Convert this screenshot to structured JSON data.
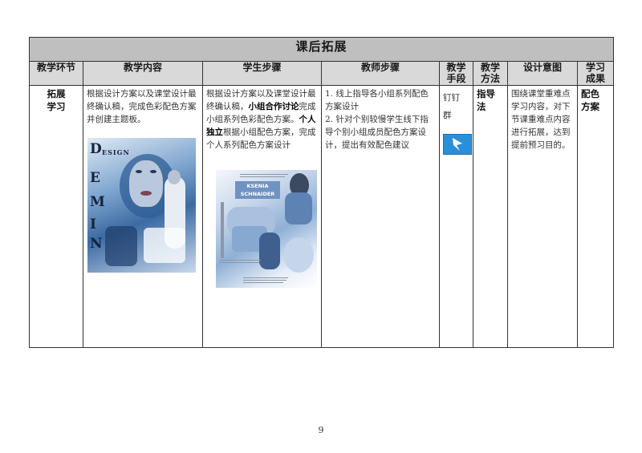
{
  "table": {
    "title": "课后拓展",
    "headers": {
      "stage": "教学环节",
      "content": "教学内容",
      "student": "学生步骤",
      "teacher": "教师步骤",
      "means": [
        "教学",
        "手段"
      ],
      "method": [
        "教学",
        "方法"
      ],
      "intent": "设计意图",
      "outcome": [
        "学习",
        "成果"
      ]
    },
    "row": {
      "stage": [
        "拓展",
        "学习"
      ],
      "content": "根据设计方案以及课堂设计最终确认稿，完成色彩配色方案并创建主题板。",
      "student": {
        "part1": "根据设计方案以及课堂设计最终确认稿，",
        "bold1": "小组合作讨论",
        "part2": "完成小组系列色彩配色方案。",
        "bold2": "个人独立",
        "part3": "根据小组配色方案，完成个人系列配色方案设计"
      },
      "teacher": {
        "line1": "1. 线上指导各小组系列配色方案设计",
        "line2": "2. 针对个别较慢学生线下指导个别小组成员配色方案设计，提出有效配色建议"
      },
      "means": [
        "钉钉",
        "群"
      ],
      "method": [
        "指导",
        "法"
      ],
      "intent": "围绕课堂重难点学习内容，对下节课重难点内容进行拓展，达到提前预习目的。",
      "outcome": [
        "配色",
        "方案"
      ]
    },
    "collage_left": {
      "word": "ESIGN",
      "letters": [
        "D",
        "E",
        "M",
        "I",
        "N"
      ]
    },
    "collage_right": {
      "name_box": [
        "KSENIA",
        "SCHNAIDER"
      ]
    }
  },
  "page_number": "9",
  "colors": {
    "title_bg": "#bfbfbf",
    "header_bg": "#d9d9d9",
    "dingtalk_blue": "#2a8fd8"
  }
}
